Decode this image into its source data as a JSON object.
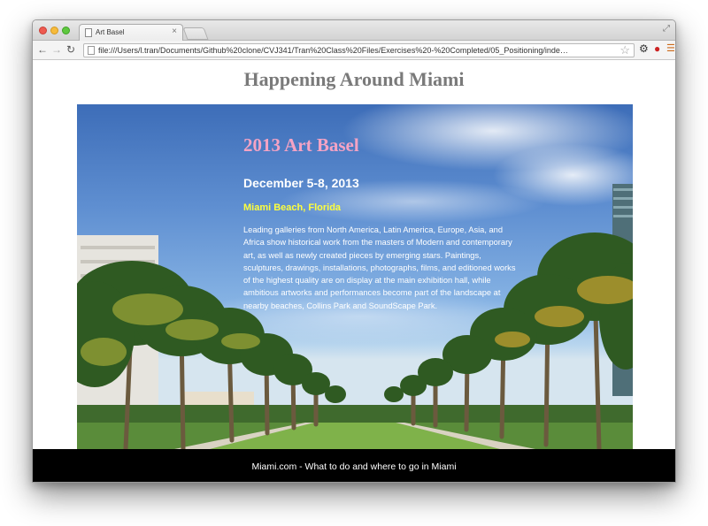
{
  "browser": {
    "tab_title": "Art Basel",
    "tab_close": "×",
    "url": "file:///Users/l.tran/Documents/Github%20clone/CVJ341/Tran%20Class%20Files/Exercises%20-%20Completed/05_Positioning/inde…",
    "icons": [
      "back-arrow-icon",
      "forward-arrow-icon",
      "reload-icon",
      "page-icon",
      "star-icon",
      "gear-icon",
      "extension-icon",
      "menu-icon"
    ]
  },
  "site": {
    "title": "Happening Around Miami"
  },
  "event": {
    "title": "2013 Art Basel",
    "date": "December 5-8, 2013",
    "location": "Miami Beach, Florida",
    "description": "Leading galleries from North America, Latin America, Europe, Asia, and Africa show historical work from the masters of Modern and contemporary art, as well as newly created pieces by emerging stars. Paintings, sculptures, drawings, installations, photographs, films, and editioned works of the highest quality are on display at the main exhibition hall, while ambitious artworks and performances become part of the landscape at nearby beaches, Collins Park and SoundScape Park."
  },
  "footer": {
    "text": "Miami.com - What to do and where to go in Miami"
  },
  "colors": {
    "site_title": "#7a7a7a",
    "event_title": "#f4a3c4",
    "event_location": "#ffff3c",
    "footer_bg": "#000000"
  }
}
